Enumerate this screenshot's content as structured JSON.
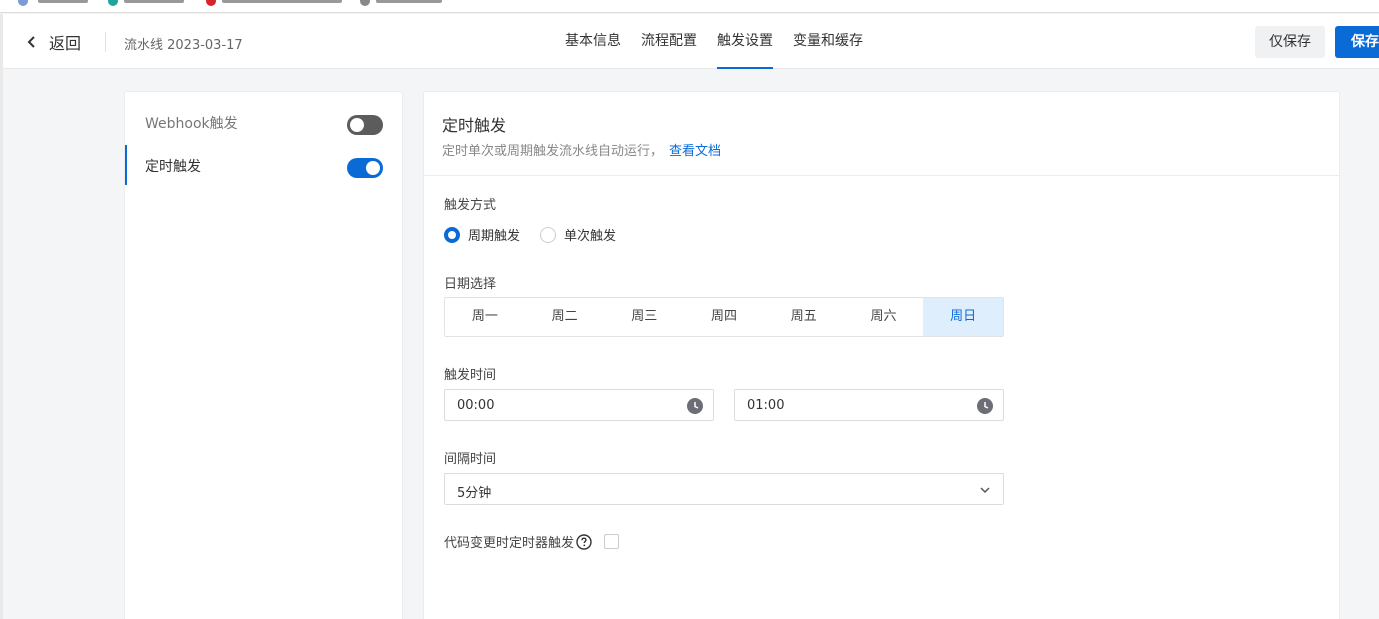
{
  "header": {
    "back_label": "返回",
    "pipeline_name": "流水线 2023-03-17",
    "tabs": [
      {
        "label": "基本信息",
        "active": false
      },
      {
        "label": "流程配置",
        "active": false
      },
      {
        "label": "触发设置",
        "active": true
      },
      {
        "label": "变量和缓存",
        "active": false
      }
    ],
    "save_only_label": "仅保存",
    "save_label": "保存"
  },
  "triggers": [
    {
      "label": "Webhook触发",
      "enabled": false,
      "active": false
    },
    {
      "label": "定时触发",
      "enabled": true,
      "active": true
    }
  ],
  "timer": {
    "title": "定时触发",
    "description": "定时单次或周期触发流水线自动运行，",
    "doc_link": "查看文档",
    "mode_label": "触发方式",
    "modes": [
      {
        "label": "周期触发",
        "checked": true
      },
      {
        "label": "单次触发",
        "checked": false
      }
    ],
    "date_label": "日期选择",
    "days": [
      {
        "label": "周一",
        "selected": false
      },
      {
        "label": "周二",
        "selected": false
      },
      {
        "label": "周三",
        "selected": false
      },
      {
        "label": "周四",
        "selected": false
      },
      {
        "label": "周五",
        "selected": false
      },
      {
        "label": "周六",
        "selected": false
      },
      {
        "label": "周日",
        "selected": true
      }
    ],
    "time_label": "触发时间",
    "start_time": "00:00",
    "end_time": "01:00",
    "interval_label": "间隔时间",
    "interval_value": "5分钟",
    "code_change_label": "代码变更时定时器触发",
    "code_change_checked": false
  },
  "colors": {
    "accent": "#0b6bd6",
    "selected_day_bg": "#deeefc",
    "toggle_off": "#5c5c5c"
  },
  "icons": {
    "back": "chevron-left-icon",
    "clock": "clock-icon",
    "dropdown": "chevron-down-icon",
    "help": "question-circle-icon"
  }
}
